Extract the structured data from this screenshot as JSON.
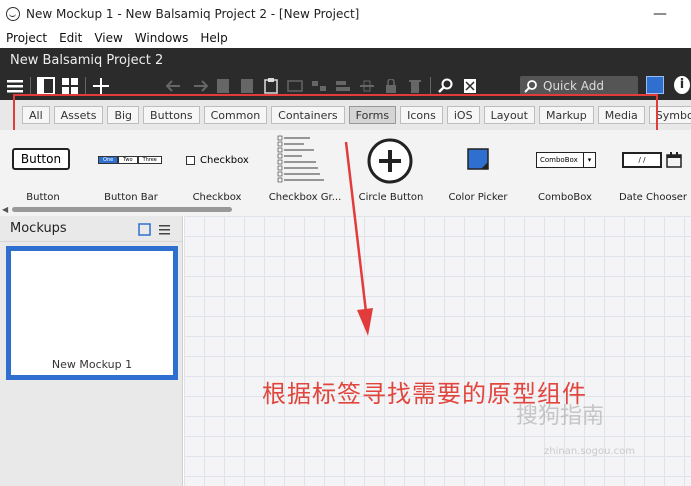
{
  "window": {
    "title": "New Mockup 1 - New Balsamiq Project 2 - [New Project]",
    "minimize_glyph": "—"
  },
  "menu": [
    "Project",
    "Edit",
    "View",
    "Windows",
    "Help"
  ],
  "project": {
    "name": "New Balsamiq Project 2"
  },
  "toolbar": {
    "quick_add_placeholder": "Quick Add"
  },
  "categories": [
    {
      "label": "All",
      "active": false
    },
    {
      "label": "Assets",
      "active": false
    },
    {
      "label": "Big",
      "active": false
    },
    {
      "label": "Buttons",
      "active": false
    },
    {
      "label": "Common",
      "active": false
    },
    {
      "label": "Containers",
      "active": false
    },
    {
      "label": "Forms",
      "active": true
    },
    {
      "label": "Icons",
      "active": false
    },
    {
      "label": "iOS",
      "active": false
    },
    {
      "label": "Layout",
      "active": false
    },
    {
      "label": "Markup",
      "active": false
    },
    {
      "label": "Media",
      "active": false
    },
    {
      "label": "Symbols",
      "active": false
    }
  ],
  "components": [
    {
      "label": "Button",
      "preview": "Button"
    },
    {
      "label": "Button Bar",
      "preview": [
        "One",
        "Two",
        "Three"
      ]
    },
    {
      "label": "Checkbox",
      "preview": "Checkbox"
    },
    {
      "label": "Checkbox Gr..."
    },
    {
      "label": "Circle Button"
    },
    {
      "label": "Color Picker"
    },
    {
      "label": "ComboBox",
      "preview": "ComboBox"
    },
    {
      "label": "Date Chooser",
      "preview": "/ /"
    }
  ],
  "mockups_panel": {
    "title": "Mockups",
    "items": [
      {
        "name": "New Mockup 1"
      }
    ]
  },
  "annotation": "根据标签寻找需要的原型组件",
  "watermark": {
    "brand": "搜狗指南",
    "url": "zhinan.sogou.com"
  },
  "colors": {
    "dark_bar": "#2b2b2b",
    "highlight_red": "#e23b3b",
    "selection_blue": "#2f6fd0"
  }
}
